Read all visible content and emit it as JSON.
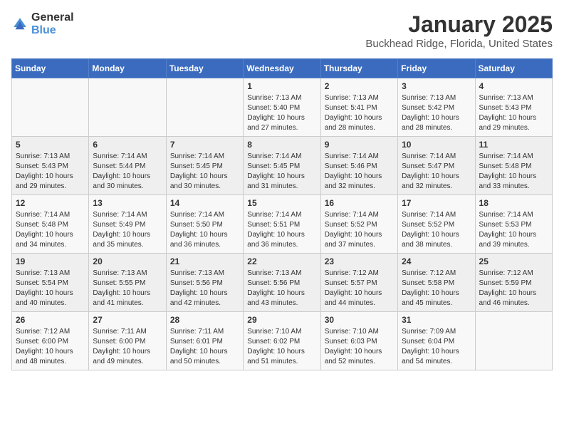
{
  "logo": {
    "general": "General",
    "blue": "Blue"
  },
  "title": {
    "month": "January 2025",
    "location": "Buckhead Ridge, Florida, United States"
  },
  "weekdays": [
    "Sunday",
    "Monday",
    "Tuesday",
    "Wednesday",
    "Thursday",
    "Friday",
    "Saturday"
  ],
  "weeks": [
    [
      {
        "day": "",
        "sunrise": "",
        "sunset": "",
        "daylight": ""
      },
      {
        "day": "",
        "sunrise": "",
        "sunset": "",
        "daylight": ""
      },
      {
        "day": "",
        "sunrise": "",
        "sunset": "",
        "daylight": ""
      },
      {
        "day": "1",
        "sunrise": "Sunrise: 7:13 AM",
        "sunset": "Sunset: 5:40 PM",
        "daylight": "Daylight: 10 hours and 27 minutes."
      },
      {
        "day": "2",
        "sunrise": "Sunrise: 7:13 AM",
        "sunset": "Sunset: 5:41 PM",
        "daylight": "Daylight: 10 hours and 28 minutes."
      },
      {
        "day": "3",
        "sunrise": "Sunrise: 7:13 AM",
        "sunset": "Sunset: 5:42 PM",
        "daylight": "Daylight: 10 hours and 28 minutes."
      },
      {
        "day": "4",
        "sunrise": "Sunrise: 7:13 AM",
        "sunset": "Sunset: 5:43 PM",
        "daylight": "Daylight: 10 hours and 29 minutes."
      }
    ],
    [
      {
        "day": "5",
        "sunrise": "Sunrise: 7:13 AM",
        "sunset": "Sunset: 5:43 PM",
        "daylight": "Daylight: 10 hours and 29 minutes."
      },
      {
        "day": "6",
        "sunrise": "Sunrise: 7:14 AM",
        "sunset": "Sunset: 5:44 PM",
        "daylight": "Daylight: 10 hours and 30 minutes."
      },
      {
        "day": "7",
        "sunrise": "Sunrise: 7:14 AM",
        "sunset": "Sunset: 5:45 PM",
        "daylight": "Daylight: 10 hours and 30 minutes."
      },
      {
        "day": "8",
        "sunrise": "Sunrise: 7:14 AM",
        "sunset": "Sunset: 5:45 PM",
        "daylight": "Daylight: 10 hours and 31 minutes."
      },
      {
        "day": "9",
        "sunrise": "Sunrise: 7:14 AM",
        "sunset": "Sunset: 5:46 PM",
        "daylight": "Daylight: 10 hours and 32 minutes."
      },
      {
        "day": "10",
        "sunrise": "Sunrise: 7:14 AM",
        "sunset": "Sunset: 5:47 PM",
        "daylight": "Daylight: 10 hours and 32 minutes."
      },
      {
        "day": "11",
        "sunrise": "Sunrise: 7:14 AM",
        "sunset": "Sunset: 5:48 PM",
        "daylight": "Daylight: 10 hours and 33 minutes."
      }
    ],
    [
      {
        "day": "12",
        "sunrise": "Sunrise: 7:14 AM",
        "sunset": "Sunset: 5:48 PM",
        "daylight": "Daylight: 10 hours and 34 minutes."
      },
      {
        "day": "13",
        "sunrise": "Sunrise: 7:14 AM",
        "sunset": "Sunset: 5:49 PM",
        "daylight": "Daylight: 10 hours and 35 minutes."
      },
      {
        "day": "14",
        "sunrise": "Sunrise: 7:14 AM",
        "sunset": "Sunset: 5:50 PM",
        "daylight": "Daylight: 10 hours and 36 minutes."
      },
      {
        "day": "15",
        "sunrise": "Sunrise: 7:14 AM",
        "sunset": "Sunset: 5:51 PM",
        "daylight": "Daylight: 10 hours and 36 minutes."
      },
      {
        "day": "16",
        "sunrise": "Sunrise: 7:14 AM",
        "sunset": "Sunset: 5:52 PM",
        "daylight": "Daylight: 10 hours and 37 minutes."
      },
      {
        "day": "17",
        "sunrise": "Sunrise: 7:14 AM",
        "sunset": "Sunset: 5:52 PM",
        "daylight": "Daylight: 10 hours and 38 minutes."
      },
      {
        "day": "18",
        "sunrise": "Sunrise: 7:14 AM",
        "sunset": "Sunset: 5:53 PM",
        "daylight": "Daylight: 10 hours and 39 minutes."
      }
    ],
    [
      {
        "day": "19",
        "sunrise": "Sunrise: 7:13 AM",
        "sunset": "Sunset: 5:54 PM",
        "daylight": "Daylight: 10 hours and 40 minutes."
      },
      {
        "day": "20",
        "sunrise": "Sunrise: 7:13 AM",
        "sunset": "Sunset: 5:55 PM",
        "daylight": "Daylight: 10 hours and 41 minutes."
      },
      {
        "day": "21",
        "sunrise": "Sunrise: 7:13 AM",
        "sunset": "Sunset: 5:56 PM",
        "daylight": "Daylight: 10 hours and 42 minutes."
      },
      {
        "day": "22",
        "sunrise": "Sunrise: 7:13 AM",
        "sunset": "Sunset: 5:56 PM",
        "daylight": "Daylight: 10 hours and 43 minutes."
      },
      {
        "day": "23",
        "sunrise": "Sunrise: 7:12 AM",
        "sunset": "Sunset: 5:57 PM",
        "daylight": "Daylight: 10 hours and 44 minutes."
      },
      {
        "day": "24",
        "sunrise": "Sunrise: 7:12 AM",
        "sunset": "Sunset: 5:58 PM",
        "daylight": "Daylight: 10 hours and 45 minutes."
      },
      {
        "day": "25",
        "sunrise": "Sunrise: 7:12 AM",
        "sunset": "Sunset: 5:59 PM",
        "daylight": "Daylight: 10 hours and 46 minutes."
      }
    ],
    [
      {
        "day": "26",
        "sunrise": "Sunrise: 7:12 AM",
        "sunset": "Sunset: 6:00 PM",
        "daylight": "Daylight: 10 hours and 48 minutes."
      },
      {
        "day": "27",
        "sunrise": "Sunrise: 7:11 AM",
        "sunset": "Sunset: 6:00 PM",
        "daylight": "Daylight: 10 hours and 49 minutes."
      },
      {
        "day": "28",
        "sunrise": "Sunrise: 7:11 AM",
        "sunset": "Sunset: 6:01 PM",
        "daylight": "Daylight: 10 hours and 50 minutes."
      },
      {
        "day": "29",
        "sunrise": "Sunrise: 7:10 AM",
        "sunset": "Sunset: 6:02 PM",
        "daylight": "Daylight: 10 hours and 51 minutes."
      },
      {
        "day": "30",
        "sunrise": "Sunrise: 7:10 AM",
        "sunset": "Sunset: 6:03 PM",
        "daylight": "Daylight: 10 hours and 52 minutes."
      },
      {
        "day": "31",
        "sunrise": "Sunrise: 7:09 AM",
        "sunset": "Sunset: 6:04 PM",
        "daylight": "Daylight: 10 hours and 54 minutes."
      },
      {
        "day": "",
        "sunrise": "",
        "sunset": "",
        "daylight": ""
      }
    ]
  ]
}
